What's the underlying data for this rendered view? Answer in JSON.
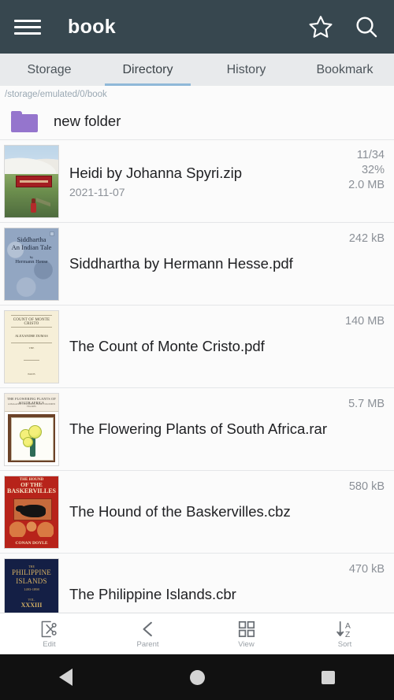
{
  "appbar": {
    "menu_icon": "hamburger-menu-icon",
    "title": "book",
    "bookmark_icon": "star-outline-icon",
    "search_icon": "search-icon"
  },
  "tabs": [
    {
      "label": "Storage",
      "active": false
    },
    {
      "label": "Directory",
      "active": true
    },
    {
      "label": "History",
      "active": false
    },
    {
      "label": "Bookmark",
      "active": false
    }
  ],
  "path": "/storage/emulated/0/book",
  "colors": {
    "appbar_bg": "#37474F",
    "tabbar_bg": "#E8EAEC",
    "tab_indicator": "#8FB8D8",
    "folder": "#9575CD",
    "list_bg": "#FBFBFB",
    "primary_text": "#202124",
    "secondary_text": "#8B9097",
    "path_text": "#9AA8B3",
    "navbar_bg": "#111111"
  },
  "folders": [
    {
      "name": "new folder",
      "icon": "folder-icon"
    }
  ],
  "files": [
    {
      "name": "Heidi by Johanna Spyri.zip",
      "date": "2021-11-07",
      "progress": "11/34",
      "percent": "32%",
      "size": "2.0 MB",
      "thumb": "heidi-cover-thumbnail"
    },
    {
      "name": "Siddhartha by Hermann Hesse.pdf",
      "date": "",
      "progress": "",
      "percent": "",
      "size": "242 kB",
      "thumb": "siddhartha-cover-thumbnail",
      "cover_text": {
        "line1": "Siddhartha",
        "line2": "An Indian Tale",
        "by": "by",
        "line3": "Hermann Hesse"
      }
    },
    {
      "name": "The Count of Monte Cristo.pdf",
      "date": "",
      "progress": "",
      "percent": "",
      "size": "140 MB",
      "thumb": "monte-cristo-cover-thumbnail",
      "cover_text": {
        "small_top": "THE",
        "title": "COUNT OF MONTE CRISTO",
        "author": "ALEXANDRE DUMAS",
        "footer": "PARIS"
      }
    },
    {
      "name": "The Flowering Plants of South Africa.rar",
      "date": "",
      "progress": "",
      "percent": "",
      "size": "5.7 MB",
      "thumb": "flowering-plants-cover-thumbnail",
      "cover_text": {
        "title": "THE FLOWERING PLANTS OF SOUTH AFRICA",
        "subtitle": "A MAGAZINE CONTAINING HAND COLOURED FIGURES"
      }
    },
    {
      "name": "The Hound of the Baskervilles.cbz",
      "date": "",
      "progress": "",
      "percent": "",
      "size": "580 kB",
      "thumb": "hound-baskervilles-cover-thumbnail",
      "cover_text": {
        "line1": "THE HOUND",
        "line2": "OF THE",
        "line3": "BASKERVILLES",
        "author": "CONAN DOYLE"
      }
    },
    {
      "name": "The Philippine Islands.cbr",
      "date": "",
      "progress": "",
      "percent": "",
      "size": "470 kB",
      "thumb": "philippine-islands-cover-thumbnail",
      "cover_text": {
        "the": "THE",
        "line1": "PHILIPPINE",
        "line2": "ISLANDS",
        "years": "1493-1898",
        "vol": "VOL.",
        "number": "XXXIII"
      }
    }
  ],
  "toolbar": [
    {
      "label": "Edit",
      "icon": "edit-scissors-icon"
    },
    {
      "label": "Parent",
      "icon": "chevron-left-icon"
    },
    {
      "label": "View",
      "icon": "grid-view-icon"
    },
    {
      "label": "Sort",
      "icon": "sort-az-icon"
    }
  ],
  "navbar": [
    {
      "name": "back",
      "icon": "triangle-back-icon"
    },
    {
      "name": "home",
      "icon": "circle-home-icon"
    },
    {
      "name": "recents",
      "icon": "square-recents-icon"
    }
  ]
}
